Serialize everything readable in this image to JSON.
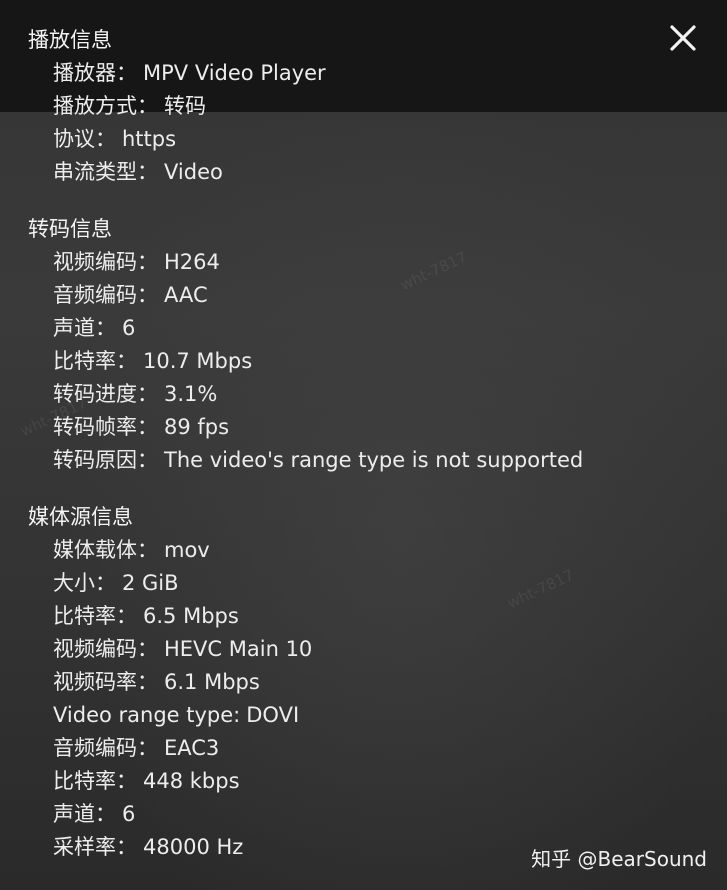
{
  "sections": [
    {
      "title": "播放信息",
      "rows": [
        {
          "label": "播放器：",
          "value": "MPV Video Player"
        },
        {
          "label": "播放方式：",
          "value": "转码"
        },
        {
          "label": "协议：",
          "value": "https"
        },
        {
          "label": "串流类型：",
          "value": "Video"
        }
      ]
    },
    {
      "title": "转码信息",
      "rows": [
        {
          "label": "视频编码：",
          "value": "H264"
        },
        {
          "label": "音频编码：",
          "value": "AAC"
        },
        {
          "label": "声道：",
          "value": "6"
        },
        {
          "label": "比特率：",
          "value": "10.7 Mbps"
        },
        {
          "label": "转码进度：",
          "value": "3.1%"
        },
        {
          "label": "转码帧率：",
          "value": "89 fps"
        },
        {
          "label": "转码原因：",
          "value": "The video's range type is not supported"
        }
      ]
    },
    {
      "title": "媒体源信息",
      "rows": [
        {
          "label": "媒体载体：",
          "value": "mov"
        },
        {
          "label": "大小：",
          "value": "2 GiB"
        },
        {
          "label": "比特率：",
          "value": "6.5 Mbps"
        },
        {
          "label": "视频编码：",
          "value": "HEVC Main 10"
        },
        {
          "label": "视频码率：",
          "value": "6.1 Mbps"
        },
        {
          "label": "Video range type:",
          "value": "DOVI"
        },
        {
          "label": "音频编码：",
          "value": "EAC3"
        },
        {
          "label": "比特率：",
          "value": "448 kbps"
        },
        {
          "label": "声道：",
          "value": "6"
        },
        {
          "label": "采样率：",
          "value": "48000 Hz"
        }
      ]
    }
  ],
  "close_icon": "close-icon",
  "credit": "知乎 @BearSound",
  "watermark": "wht-7817",
  "colors": {
    "text": "#eeeeee",
    "top_band": "#161616",
    "background": "#3a3a3a"
  }
}
